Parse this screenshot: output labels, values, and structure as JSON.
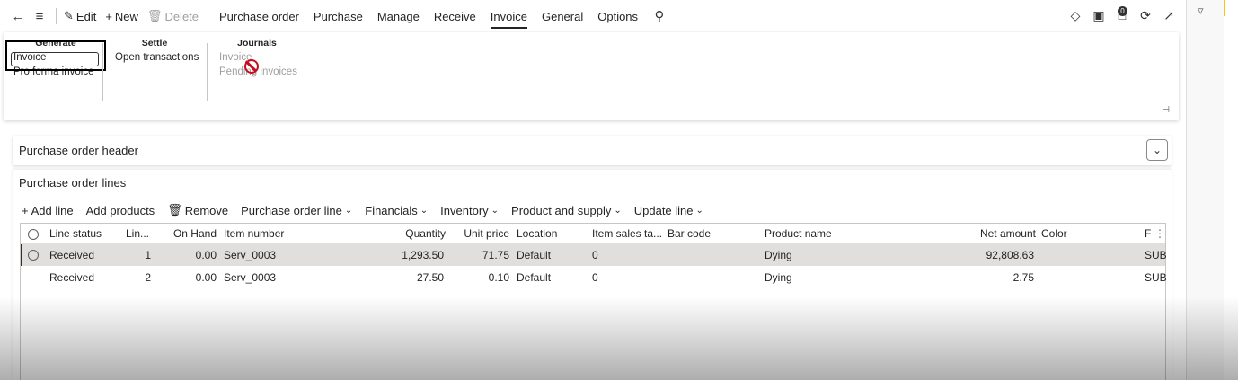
{
  "actionbar": {
    "back_icon": "back-arrow-icon",
    "menu_icon": "hamburger-icon",
    "edit_label": "Edit",
    "new_label": "New",
    "delete_label": "Delete",
    "tabs": [
      {
        "label": "Purchase order"
      },
      {
        "label": "Purchase"
      },
      {
        "label": "Manage"
      },
      {
        "label": "Receive"
      },
      {
        "label": "Invoice",
        "active": true
      },
      {
        "label": "General"
      },
      {
        "label": "Options"
      }
    ],
    "badge_count": "0"
  },
  "ribbon": {
    "generate": {
      "title": "Generate",
      "items": [
        "Invoice",
        "Pro forma invoice"
      ]
    },
    "settle": {
      "title": "Settle",
      "items": [
        "Open transactions"
      ]
    },
    "journals": {
      "title": "Journals",
      "items": [
        "Invoice",
        "Pending invoices"
      ]
    }
  },
  "header_section": {
    "title": "Purchase order header"
  },
  "lines_section": {
    "title": "Purchase order lines",
    "toolbar": {
      "add_line": "Add line",
      "add_products": "Add products",
      "remove": "Remove",
      "menus": [
        "Purchase order line",
        "Financials",
        "Inventory",
        "Product and supply",
        "Update line"
      ]
    },
    "columns": [
      "Line status",
      "Lin...",
      "On Hand",
      "Item number",
      "Quantity",
      "Unit price",
      "Location",
      "Item sales ta...",
      "Bar code",
      "Product name",
      "Net amount",
      "Color",
      "F"
    ],
    "rows": [
      {
        "status": "Received",
        "line": "1",
        "onhand": "0.00",
        "item": "Serv_0003",
        "qty": "1,293.50",
        "price": "71.75",
        "location": "Default",
        "tax": "0",
        "barcode": "",
        "product": "Dying",
        "net": "92,808.63",
        "color": "",
        "f": "SUB"
      },
      {
        "status": "Received",
        "line": "2",
        "onhand": "0.00",
        "item": "Serv_0003",
        "qty": "27.50",
        "price": "0.10",
        "location": "Default",
        "tax": "0",
        "barcode": "",
        "product": "Dying",
        "net": "2.75",
        "color": "",
        "f": "SUB"
      }
    ]
  },
  "colors": {
    "active_underline": "#252423",
    "noentry": "#c50f1f",
    "selected_row": "#e1dfdd"
  }
}
